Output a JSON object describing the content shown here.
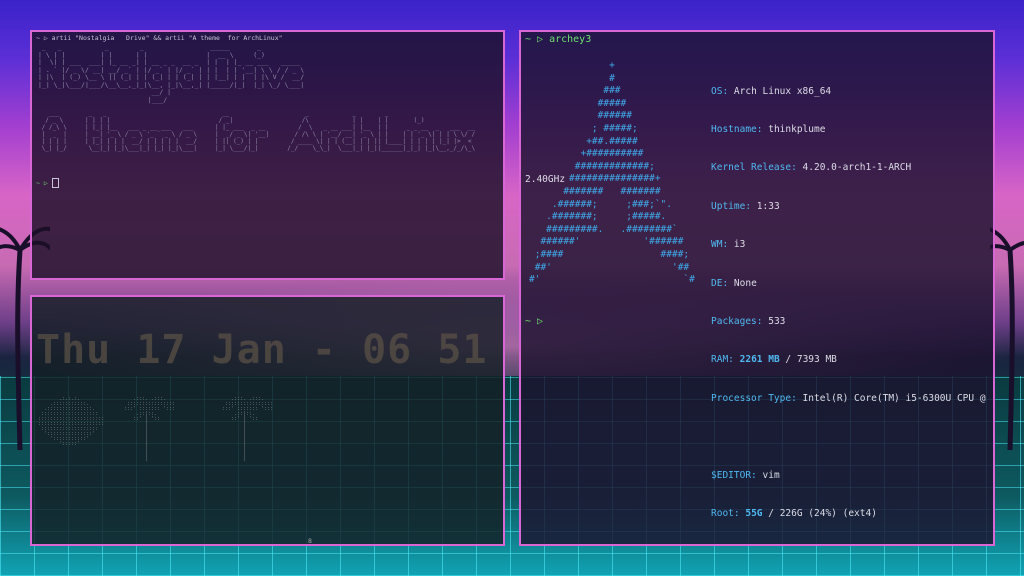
{
  "top_left": {
    "command": "~ ▷ artii \"Nostalgia   Drive\" && artii \"A theme  for ArchLinux\"",
    "ascii_1": " _   _           _        _                 _____       _              \n| \\ | |         | |      | |               |  __ \\     (_)             \n|  \\| | ___  ___| |_ __ _| | __ _ _  __ _  | |  | |_ __ ___   _____    \n| . ` |/ _ \\/ __| __/ _` | |/ _` | |/ _` | | |  | | '__| \\ \\ / / _ \\   \n| |\\  | (_) \\__ \\ || (_| | | (_| | | (_| | | |__| | |  | |\\ V /  __/   \n|_| \\_|\\___/|___/\\__\\__,_|_|\\__, |_|\\__,_| |_____/|_|  |_| \\_/ \\___|   \n                             __/ |                                     \n                            |___/                                      ",
    "ascii_2": "   ___        _   _                                __                     _            _        _ \n  / _ \\      | | | |                              / _|                   /\\            | |    | |       (_)\n / /_\\ \\     | |_| |__   ___ _ __ ___   ___      | |_ ___  _ __         /  \\   _ __ ___| |__  | |     _ _ __  _   ___  __\n |  _  |     | __| '_ \\ / _ \\ '_ ` _ \\ / _ \\     |  _/ _ \\| '__|       / /\\ \\ | '__/ __| '_ \\ | |    | | '_ \\| | | \\ \\/ /\n | | | |     | |_| | | |  __/ | | | | |  __/     | || (_) | |         / ____ \\| | | (__| | | || |____| | | | | |_| |>  < \n \\_| |_/      \\__|_| |_|\\___|_| |_| |_|\\___|     |_| \\___/|_|        /_/    \\_\\_|  \\___|_| |_||______|_|_| |_|\\__,_/_/\\_\\",
    "prompt": "~ ▷ "
  },
  "bottom_left": {
    "clock": "Thu 17 Jan - 06 51",
    "marker": "8"
  },
  "right": {
    "command": "~ ▷ archey3",
    "logo": "              +\n              #\n             ###\n            #####\n            ######\n           ; #####;\n          +##.#####\n         +##########\n        #############;\n       ###############+\n      #######   #######\n    .######;     ;###;`\".\n   .#######;     ;#####.\n   #########.   .########`\n  ######'           '######\n ;####                 ####;\n ##'                     '##\n#'                         `#",
    "cpu_wrap": "2.40GHz",
    "info": [
      {
        "key": "OS:",
        "value": "Arch Linux x86_64"
      },
      {
        "key": "Hostname:",
        "value": "thinkplume"
      },
      {
        "key": "Kernel Release:",
        "value": "4.20.0-arch1-1-ARCH"
      },
      {
        "key": "Uptime:",
        "value": "1:33"
      },
      {
        "key": "WM:",
        "value": "i3"
      },
      {
        "key": "DE:",
        "value": "None"
      },
      {
        "key": "Packages:",
        "value": "533"
      },
      {
        "key": "RAM:",
        "value_hl": "2261 MB",
        "value": "/ 7393 MB"
      },
      {
        "key": "Processor Type:",
        "value": "Intel(R) Core(TM) i5-6300U CPU @"
      },
      {
        "key": "",
        "value": ""
      },
      {
        "key": "$EDITOR:",
        "value": "vim"
      },
      {
        "key": "Root:",
        "value_hl": "55G",
        "value": "/ 226G (24%) (ext4)"
      }
    ],
    "prompt": "~ ▷"
  },
  "colors": {
    "border": "#d866d4",
    "prompt": "#6ee06e",
    "accent": "#4fb8f0"
  }
}
